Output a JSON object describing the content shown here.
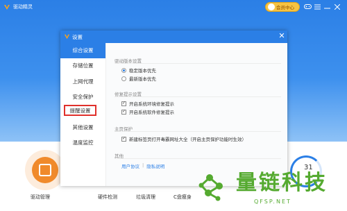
{
  "app": {
    "title": "驱动精灵",
    "vip_label": "会员中心"
  },
  "bottom": {
    "driver_mgmt": "驱动管理",
    "hardware_check": "硬件检测",
    "junk_clean": "垃圾清理",
    "c_slim": "C盘瘦身",
    "score": "31"
  },
  "dialog": {
    "title": "设置",
    "sidebar": [
      {
        "label": "综合设置",
        "active": true
      },
      {
        "label": "存储位置"
      },
      {
        "label": "上网代理"
      },
      {
        "label": "安全保护"
      },
      {
        "label": "提醒设置",
        "highlighted": true
      },
      {
        "label": "其他设置"
      },
      {
        "label": "温度监控"
      }
    ],
    "sections": {
      "driver_version": {
        "title": "驱动版本设置",
        "options": [
          "稳定版本优先",
          "最新版本优先"
        ],
        "selected": "稳定版本优先"
      },
      "repair_tip": {
        "title": "修复提示设置",
        "options": [
          "开启系统环境修复提示",
          "开启系统软件修复提示"
        ]
      },
      "homepage": {
        "title": "主页保护",
        "option": "新建标签页打开毒霸网址大全（开启主页保护功能时生效）"
      },
      "other": {
        "title": "其他",
        "links": [
          "用户协议",
          "隐私说明"
        ],
        "separator": "|"
      }
    }
  },
  "watermark": {
    "cn": "量链科技",
    "en": "QFSP.NET"
  },
  "colors": {
    "accent": "#2b7fe6",
    "highlight_border": "#e0302b",
    "watermark": "#55aa30"
  }
}
